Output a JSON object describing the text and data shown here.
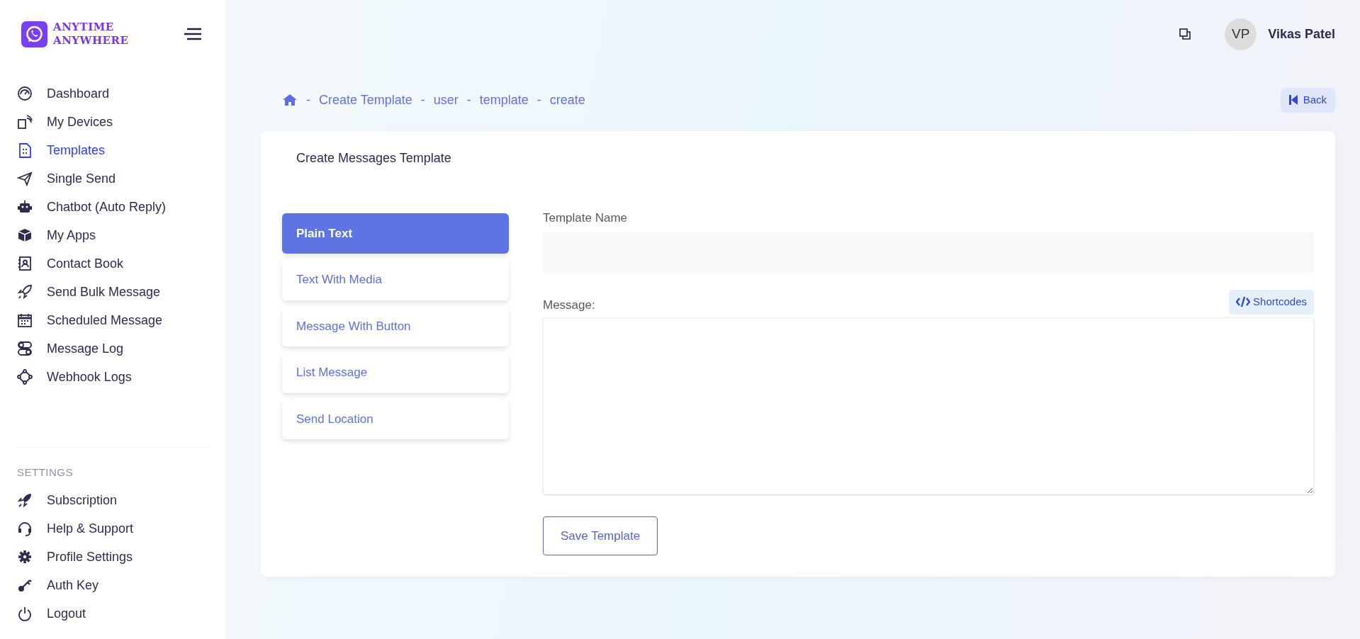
{
  "brand": {
    "line_1": "ANYTIME",
    "line_2": "ANYWHERE"
  },
  "sidebar": {
    "items": [
      {
        "label": "Dashboard",
        "selected": false
      },
      {
        "label": "My Devices",
        "selected": false
      },
      {
        "label": "Templates",
        "selected": true
      },
      {
        "label": "Single Send",
        "selected": false
      },
      {
        "label": "Chatbot (Auto Reply)",
        "selected": false
      },
      {
        "label": "My Apps",
        "selected": false
      },
      {
        "label": "Contact Book",
        "selected": false
      },
      {
        "label": "Send Bulk Message",
        "selected": false
      },
      {
        "label": "Scheduled Message",
        "selected": false
      },
      {
        "label": "Message Log",
        "selected": false
      },
      {
        "label": "Webhook Logs",
        "selected": false
      }
    ],
    "settings_heading": "SETTINGS",
    "settings_items": [
      {
        "label": "Subscription",
        "selected": false
      },
      {
        "label": "Help & Support",
        "selected": false
      },
      {
        "label": "Profile Settings",
        "selected": false
      },
      {
        "label": "Auth Key",
        "selected": false
      },
      {
        "label": "Logout",
        "selected": false
      }
    ]
  },
  "user": {
    "initials": "VP",
    "name": "Vikas Patel"
  },
  "breadcrumb": [
    {
      "separator": "-",
      "label": "Create Template"
    },
    {
      "separator": "-",
      "label": "user"
    },
    {
      "separator": "-",
      "label": "template"
    },
    {
      "separator": "-",
      "label": "create"
    }
  ],
  "back_button": "Back",
  "card": {
    "title": "Create Messages Template",
    "tabs": [
      {
        "label": "Plain Text",
        "selected": true
      },
      {
        "label": "Text With Media",
        "selected": false
      },
      {
        "label": "Message With Button",
        "selected": false
      },
      {
        "label": "List Message",
        "selected": false
      },
      {
        "label": "Send Location",
        "selected": false
      }
    ],
    "template_name_label": "Template Name",
    "message_label": "Message:",
    "shortcodes_button": "Shortcodes",
    "save_button": "Save Template"
  }
}
